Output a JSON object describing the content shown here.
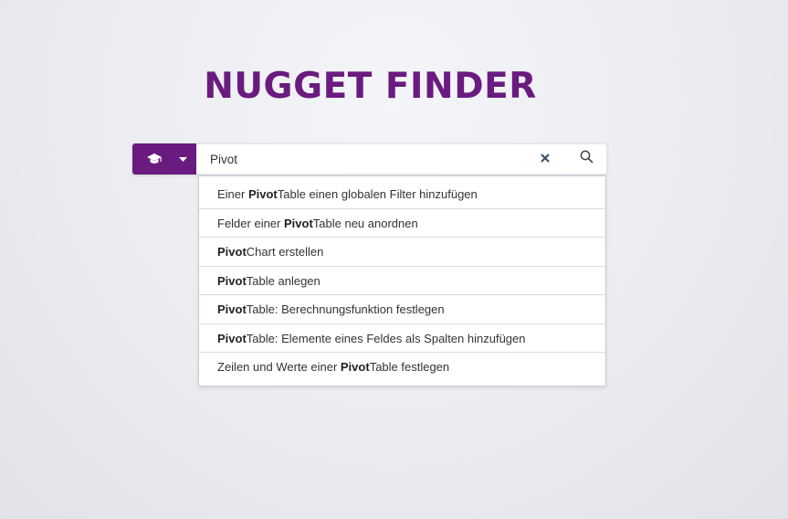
{
  "title": "NUGGET FINDER",
  "colors": {
    "brand": "#6a1b7f",
    "clear_icon": "#3a4a6b",
    "search_icon": "#444444"
  },
  "category_button": {
    "icon": "graduation-cap-icon",
    "caret_icon": "caret-down-icon"
  },
  "search": {
    "value": "Pivot",
    "clear_icon": "close-icon",
    "search_icon": "search-icon"
  },
  "suggestions": [
    {
      "before": "Einer ",
      "match": "Pivot",
      "after": "Table einen globalen Filter hinzufügen"
    },
    {
      "before": "Felder einer ",
      "match": "Pivot",
      "after": "Table neu anordnen"
    },
    {
      "before": "",
      "match": "Pivot",
      "after": "Chart erstellen"
    },
    {
      "before": "",
      "match": "Pivot",
      "after": "Table anlegen"
    },
    {
      "before": "",
      "match": "Pivot",
      "after": "Table: Berechnungsfunktion festlegen"
    },
    {
      "before": "",
      "match": "Pivot",
      "after": "Table: Elemente eines Feldes als Spalten hinzufügen"
    },
    {
      "before": "Zeilen und Werte einer ",
      "match": "Pivot",
      "after": "Table festlegen"
    }
  ]
}
